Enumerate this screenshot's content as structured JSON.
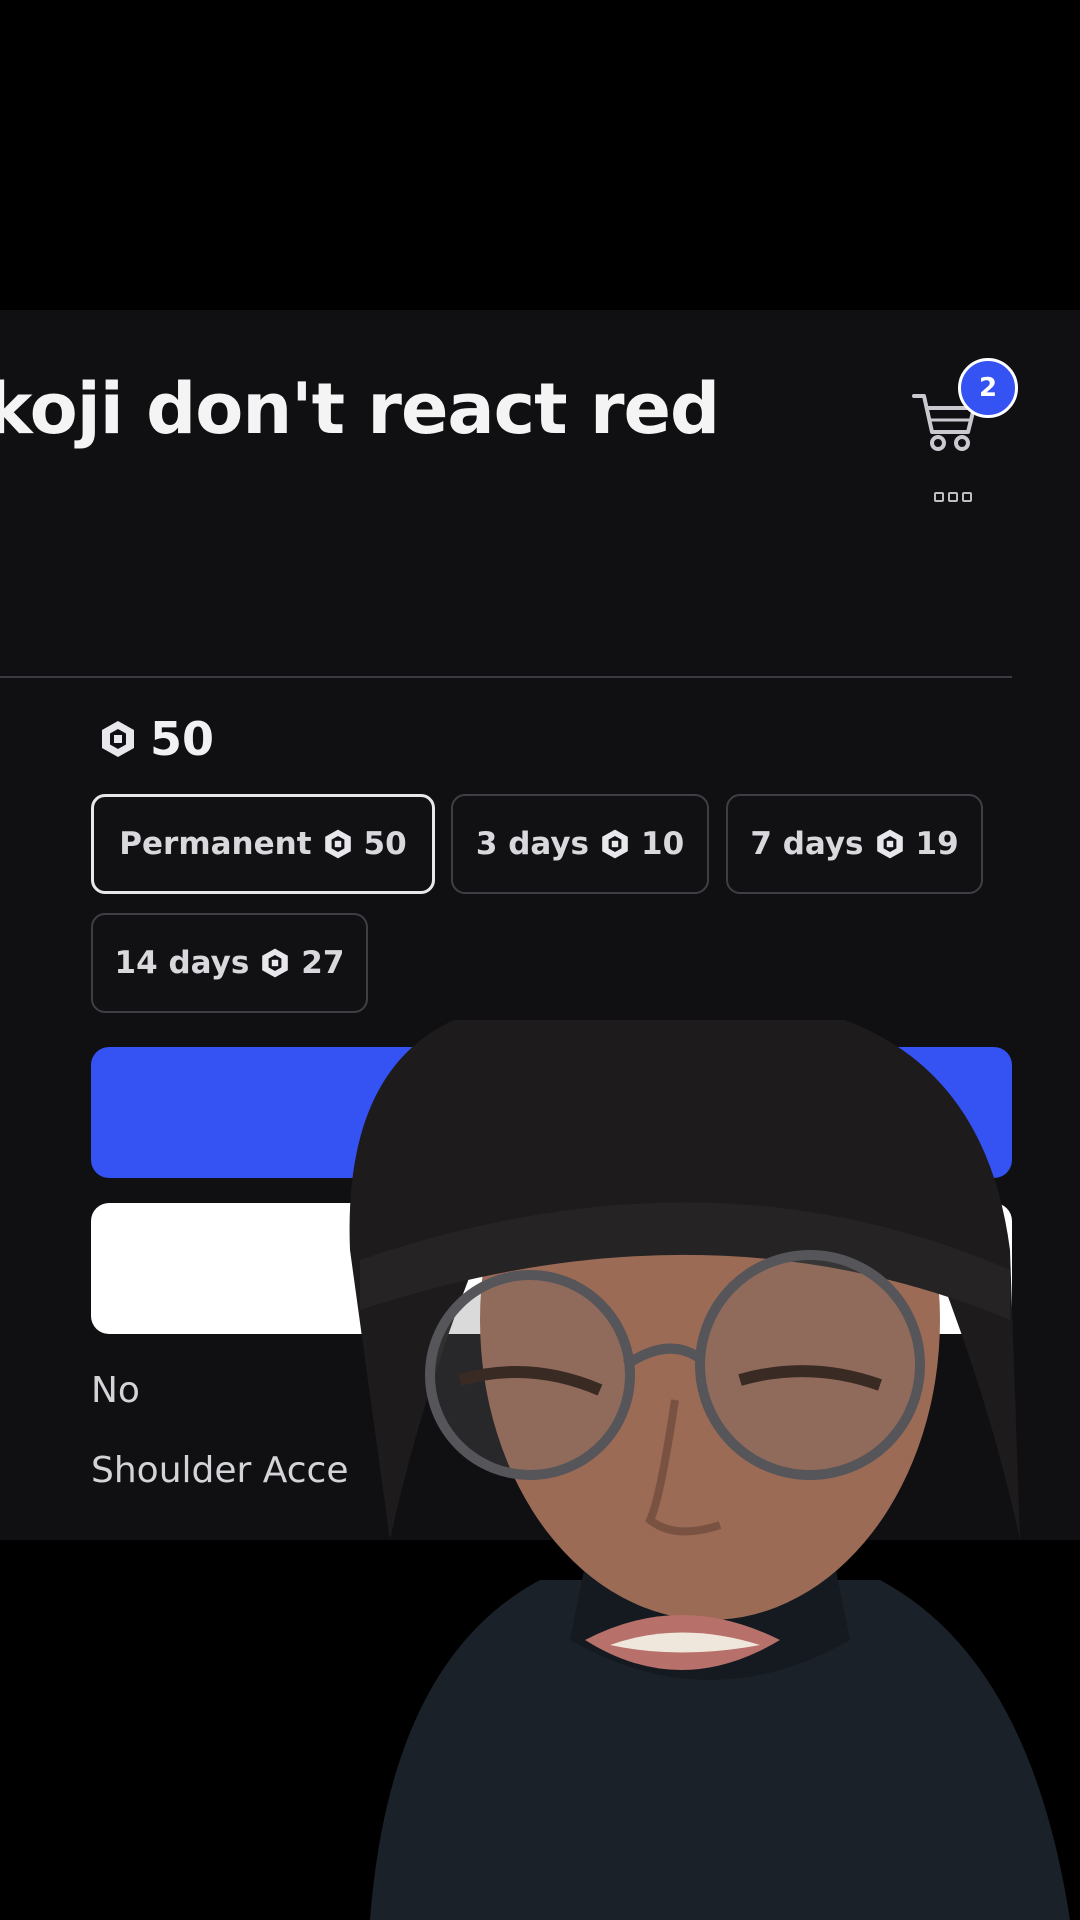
{
  "header": {
    "title": "koji don't react red",
    "cart_icon": "shopping-cart-icon",
    "cart_count": "2",
    "more_icon": "more-options-icon"
  },
  "price": {
    "currency_icon": "robux-icon",
    "amount": "50"
  },
  "duration_options": [
    {
      "label": "Permanent",
      "price": "50",
      "selected": true
    },
    {
      "label": "3 days",
      "price": "10",
      "selected": false
    },
    {
      "label": "7 days",
      "price": "19",
      "selected": false
    },
    {
      "label": "14 days",
      "price": "27",
      "selected": false
    }
  ],
  "details": {
    "line1": "No",
    "line2": "Shoulder Acce"
  },
  "colors": {
    "accent": "#3552f2",
    "background": "#101013",
    "selected_border": "#e8e8ec"
  }
}
